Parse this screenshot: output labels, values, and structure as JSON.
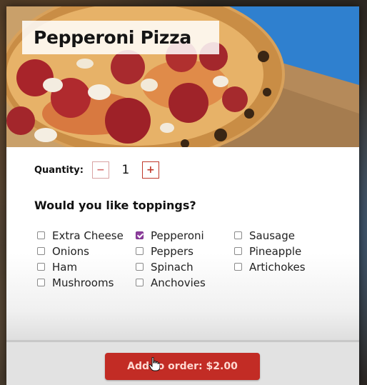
{
  "item": {
    "title": "Pepperoni Pizza"
  },
  "quantity": {
    "label": "Quantity:",
    "value": "1",
    "minus_symbol": "−",
    "plus_symbol": "+"
  },
  "toppings": {
    "heading": "Would you like toppings?",
    "options": [
      {
        "label": "Extra Cheese",
        "checked": false
      },
      {
        "label": "Pepperoni",
        "checked": true
      },
      {
        "label": "Sausage",
        "checked": false
      },
      {
        "label": "Onions",
        "checked": false
      },
      {
        "label": "Peppers",
        "checked": false
      },
      {
        "label": "Pineapple",
        "checked": false
      },
      {
        "label": "Ham",
        "checked": false
      },
      {
        "label": "Spinach",
        "checked": false
      },
      {
        "label": "Artichokes",
        "checked": false
      },
      {
        "label": "Mushrooms",
        "checked": false
      },
      {
        "label": "Anchovies",
        "checked": false
      }
    ]
  },
  "footer": {
    "add_button_label": "Add to order: $2.00"
  },
  "colors": {
    "accent_red": "#c22c25",
    "checkbox_checked": "#8e3f9e"
  },
  "icons": {
    "cursor": "hand-pointer-icon"
  }
}
